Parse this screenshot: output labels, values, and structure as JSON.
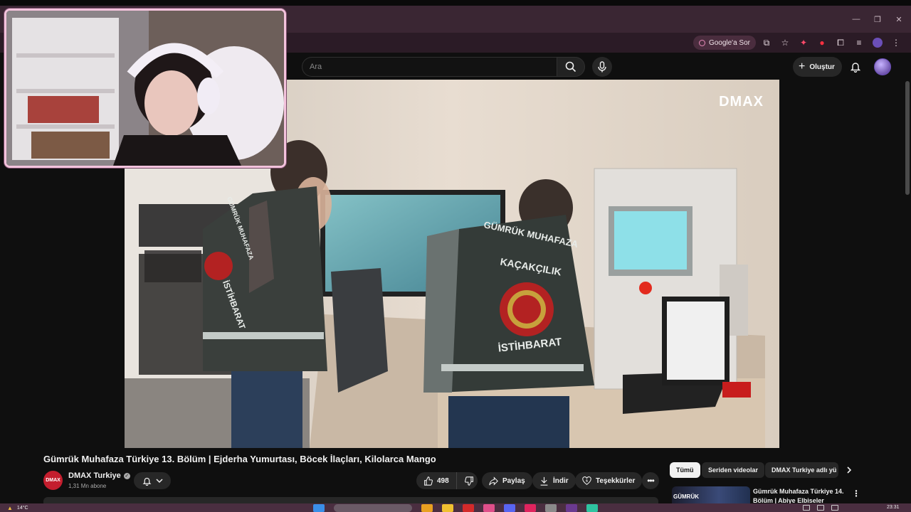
{
  "browser": {
    "window_controls": {
      "minimize": "—",
      "restore": "❐",
      "close": "✕"
    },
    "toolbar": {
      "google_sor_label": "Google'a Sor"
    }
  },
  "masthead": {
    "search_placeholder": "Ara",
    "create_label": "Oluştur"
  },
  "video": {
    "watermark": "DMAX",
    "title": "Gümrük Muhafaza Türkiye 13. Bölüm | Ejderha Yumurtası, Böcek İlaçları, Kilolarca Mango",
    "vest_texts": {
      "left_top": "GÜMRÜK MUHAFAZA",
      "left_bottom": "İSTİHBARAT",
      "right_top": "GÜMRÜK MUHAFAZA",
      "right_middle": "KAÇAKÇILIK",
      "right_bottom": "İSTİHBARAT"
    }
  },
  "channel": {
    "name": "DMAX Turkiye",
    "subscribers": "1,31 Mn abone",
    "avatar_text": "DMAX"
  },
  "actions": {
    "likes": "498",
    "share": "Paylaş",
    "download": "İndir",
    "thanks": "Teşekkürler"
  },
  "chips": [
    {
      "label": "Tümü",
      "active": true
    },
    {
      "label": "Seriden videolar",
      "active": false
    },
    {
      "label": "DMAX Turkiye adlı yü",
      "active": false
    }
  ],
  "recommendation": {
    "thumb_text": "GÜMRÜK",
    "title": "Gümrük Muhafaza Türkiye 14. Bölüm | Abiye Elbiseler"
  },
  "taskbar": {
    "temperature": "14°C",
    "time": "23:31"
  }
}
